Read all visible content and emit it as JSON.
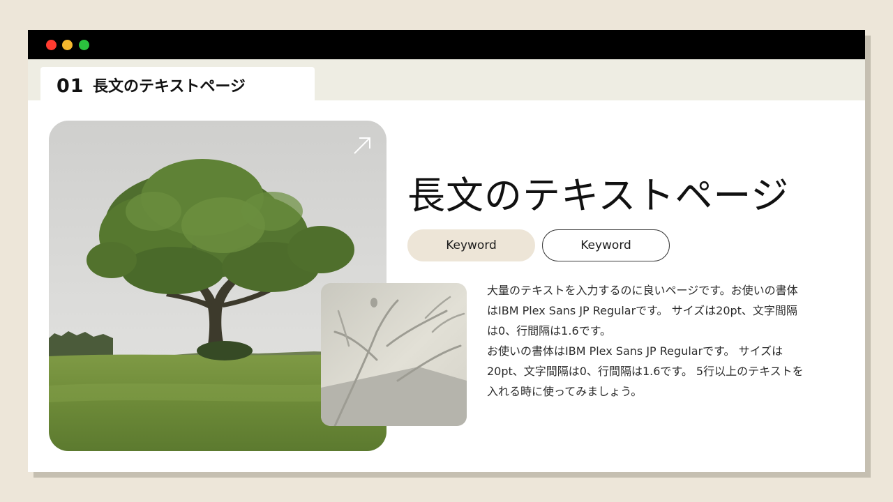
{
  "window": {
    "controls": {
      "close_color": "#ff3b30",
      "minimize_color": "#f5b82e",
      "maximize_color": "#2bc13e"
    }
  },
  "tab": {
    "number": "01",
    "title": "長文のテキストページ"
  },
  "main": {
    "image_icon": "arrow-up-right-icon",
    "heading": "長文のテキストページ",
    "keywords": [
      "Keyword",
      "Keyword"
    ],
    "paragraphs": [
      "大量のテキストを入力するのに良いページです。お使いの書体はIBM Plex Sans JP Regularです。 サイズは20pt、文字間隔は0、行間隔は1.6です。",
      "お使いの書体はIBM Plex Sans JP Regularです。 サイズは20pt、文字間隔は0、行間隔は1.6です。 5行以上のテキストを入れる時に使ってみましょう。"
    ]
  },
  "colors": {
    "page_background": "#ede6d9",
    "titlebar": "#000000",
    "tabstrip": "#eeede3",
    "keyword_fill": "#ede5d7"
  }
}
